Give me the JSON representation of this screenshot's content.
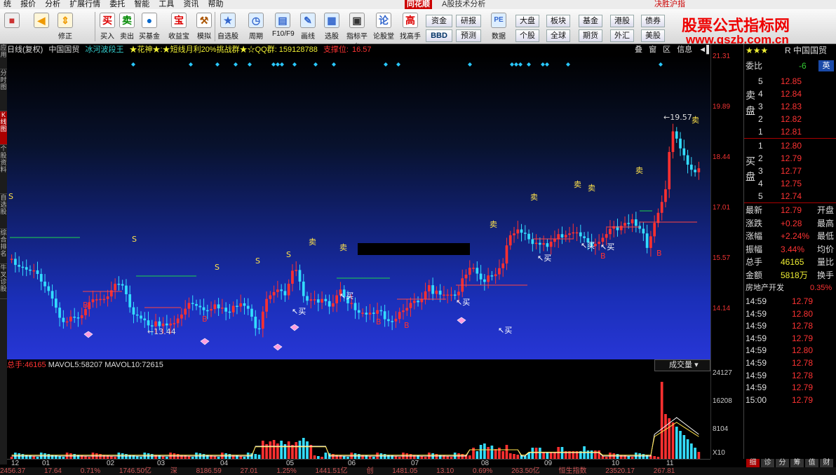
{
  "menu": {
    "items": [
      "统",
      "报价",
      "分析",
      "扩展行情",
      "委托",
      "智能",
      "工具",
      "资讯",
      "帮助"
    ],
    "brand": "同花顺",
    "app_title": "A股技术分析",
    "right": "决胜沪指"
  },
  "toolbar": {
    "nav": [
      {
        "label": "",
        "icon": "home-icon"
      },
      {
        "label": "",
        "icon": "back-icon"
      },
      {
        "label": "修正",
        "icon": "up-down-arrows-icon"
      }
    ],
    "trade": [
      {
        "label": "买入",
        "icon_text": "买"
      },
      {
        "label": "卖出",
        "icon_text": "卖"
      },
      {
        "label": "买基金",
        "icon_text": "●"
      },
      {
        "label": "收益宝",
        "icon_text": "宝"
      },
      {
        "label": "模拟",
        "icon_text": "⚒"
      }
    ],
    "views": [
      {
        "label": "自选股",
        "icon_text": "★"
      },
      {
        "label": "周期",
        "icon_text": "◷"
      },
      {
        "label": "F10/F9",
        "icon_text": "▤"
      },
      {
        "label": "画线",
        "icon_text": "✎"
      },
      {
        "label": "选股",
        "icon_text": "▦"
      },
      {
        "label": "指标平台",
        "icon_text": "▣"
      },
      {
        "label": "论股堂",
        "icon_text": "论"
      },
      {
        "label": "找高手",
        "icon_text": "高"
      },
      {
        "label": "数据",
        "icon_text": "PE"
      }
    ],
    "small_buttons": [
      "资金",
      "研报",
      "BBD",
      "预测",
      "大盘",
      "板块",
      "基金",
      "港股",
      "债券",
      "个股",
      "全球",
      "期货",
      "外汇",
      "美股"
    ]
  },
  "watermark": {
    "title": "股票公式指标网",
    "url": "www.gszb.com.cn"
  },
  "left_tabs": [
    "应用",
    "分时图",
    "K线图",
    "个股资料",
    "自选股",
    "综合排名",
    "牛叉诊股"
  ],
  "chart_header": {
    "period": "日线(复权)",
    "stock": "中国国贸",
    "indicator": "冰河波段王",
    "note": "★花神★:★短线月利20%挑战群★☆QQ群: 159128788",
    "support_label": "支撑位:",
    "support_value": "16.57"
  },
  "panel_buttons": [
    "叠",
    "窗",
    "区",
    "信息",
    "◄▌"
  ],
  "price_scale": [
    "21.31",
    "19.89",
    "18.44",
    "17.01",
    "15.57",
    "14.14"
  ],
  "chart_data": {
    "type": "candlestick",
    "title": "中国国贸",
    "close": [
      15.98,
      15.81,
      15.76,
      15.75,
      15.68,
      15.65,
      15.66,
      15.56,
      15.35,
      15.22,
      15.09,
      14.88,
      14.63,
      14.35,
      14.23,
      14.25,
      14.38,
      14.36,
      14.34,
      14.42,
      14.59,
      14.78,
      14.86,
      14.86,
      14.87,
      14.87,
      14.94,
      15.11,
      15.29,
      15.28,
      15.24,
      15.0,
      14.64,
      14.44,
      14.41,
      14.33,
      14.28,
      14.14,
      14.11,
      14.25,
      14.12,
      14.19,
      14.14,
      14.19,
      14.2,
      14.33,
      14.44,
      14.6,
      14.76,
      14.73,
      14.68,
      14.64,
      14.56,
      14.55,
      14.59,
      14.72,
      14.61,
      14.63,
      14.52,
      14.5,
      14.68,
      14.66,
      14.75,
      14.68,
      14.6,
      14.38,
      14.06,
      14.05,
      14.52,
      14.87,
      14.97,
      15.06,
      15.13,
      15.09,
      14.97,
      15.29,
      15.65,
      15.67,
      15.35,
      14.95,
      14.82,
      14.86,
      14.86,
      14.77,
      14.87,
      14.81,
      14.66,
      14.75,
      14.97,
      15.13,
      14.92,
      14.75,
      14.76,
      14.56,
      14.49,
      14.49,
      14.44,
      14.49,
      14.46,
      14.56,
      14.53,
      14.31,
      14.26,
      14.25,
      14.32,
      14.51,
      14.55,
      14.62,
      14.76,
      14.82,
      14.78,
      14.87,
      15.08,
      15.25,
      15.01,
      15.1,
      14.99,
      14.99,
      14.99,
      14.99,
      14.97,
      15.07,
      15.44,
      15.54,
      15.73,
      15.73,
      15.57,
      15.41,
      15.34,
      15.52,
      15.5,
      15.55,
      15.72,
      15.85,
      16.35,
      16.63,
      16.68,
      16.79,
      16.7,
      16.67,
      16.52,
      16.39,
      16.42,
      16.37,
      16.41,
      16.31,
      16.45,
      16.52,
      16.66,
      16.57,
      16.64,
      16.68,
      16.71,
      16.71,
      16.6,
      16.55,
      16.43,
      16.33,
      16.39,
      16.45,
      16.56,
      16.66,
      16.81,
      16.88,
      16.77,
      16.89,
      16.97,
      16.96,
      17.07,
      16.89,
      16.81,
      16.68,
      16.28,
      16.6,
      16.97,
      17.25,
      17.55,
      17.9,
      18.93,
      19.5,
      19.3,
      19.03,
      18.84,
      18.58,
      18.44,
      18.37,
      18.48
    ],
    "x_ticks": [
      "12",
      "01",
      "02",
      "03",
      "04",
      "05",
      "06",
      "07",
      "08",
      "09",
      "10",
      "11"
    ],
    "markers": [
      "买",
      "卖",
      "S",
      "B"
    ],
    "price_annotations": [
      "13.44",
      "19.57"
    ]
  },
  "volume": {
    "label_total": "总手:",
    "total": "46165",
    "label_ma5": "MAVOL5:",
    "ma5": "58207",
    "label_ma10": "MAVOL10:",
    "ma10": "72615",
    "dropdown": "成交量",
    "scale": [
      "24127",
      "16208",
      "8104",
      "X10"
    ]
  },
  "bottom_strip": [
    "2456.37",
    "17.64",
    "0.71%",
    "1746.50亿",
    "深",
    "8186.59",
    "27.01",
    "1.25%",
    "1441.51亿",
    "创",
    "1481.05",
    "13.10",
    "0.69%",
    "263.50亿",
    "恒生指数",
    "23520.17",
    "267.81"
  ],
  "quote": {
    "header_stars": "★★★",
    "header_flag": "R",
    "name": "中国国贸",
    "weibi_label": "委比",
    "weibi_value": "-6",
    "badge": "英",
    "sell_label": [
      "卖",
      "盘"
    ],
    "buy_label": [
      "买",
      "盘"
    ],
    "sell": [
      {
        "lvl": "5",
        "price": "12.85"
      },
      {
        "lvl": "4",
        "price": "12.84"
      },
      {
        "lvl": "3",
        "price": "12.83"
      },
      {
        "lvl": "2",
        "price": "12.82"
      },
      {
        "lvl": "1",
        "price": "12.81"
      }
    ],
    "buy": [
      {
        "lvl": "1",
        "price": "12.80"
      },
      {
        "lvl": "2",
        "price": "12.79"
      },
      {
        "lvl": "3",
        "price": "12.77"
      },
      {
        "lvl": "4",
        "price": "12.75"
      },
      {
        "lvl": "5",
        "price": "12.74"
      }
    ],
    "stats": [
      {
        "k": "最新",
        "v": "12.79",
        "k2": "开盘"
      },
      {
        "k": "涨跌",
        "v": "+0.28",
        "k2": "最高"
      },
      {
        "k": "涨幅",
        "v": "+2.24%",
        "k2": "最低"
      },
      {
        "k": "振幅",
        "v": "3.44%",
        "k2": "均价"
      },
      {
        "k": "总手",
        "v": "46165",
        "k2": "量比"
      },
      {
        "k": "金额",
        "v": "5818万",
        "k2": "换手"
      }
    ],
    "sector": "房地产开发",
    "sector_chg": "0.35%",
    "ticks": [
      {
        "t": "14:59",
        "p": "12.79"
      },
      {
        "t": "14:59",
        "p": "12.80"
      },
      {
        "t": "14:59",
        "p": "12.78"
      },
      {
        "t": "14:59",
        "p": "12.79"
      },
      {
        "t": "14:59",
        "p": "12.80"
      },
      {
        "t": "14:59",
        "p": "12.78"
      },
      {
        "t": "14:59",
        "p": "12.78"
      },
      {
        "t": "14:59",
        "p": "12.79"
      },
      {
        "t": "15:00",
        "p": "12.79"
      }
    ],
    "tabs": [
      "细",
      "诊",
      "分",
      "筹",
      "值",
      "财"
    ]
  }
}
